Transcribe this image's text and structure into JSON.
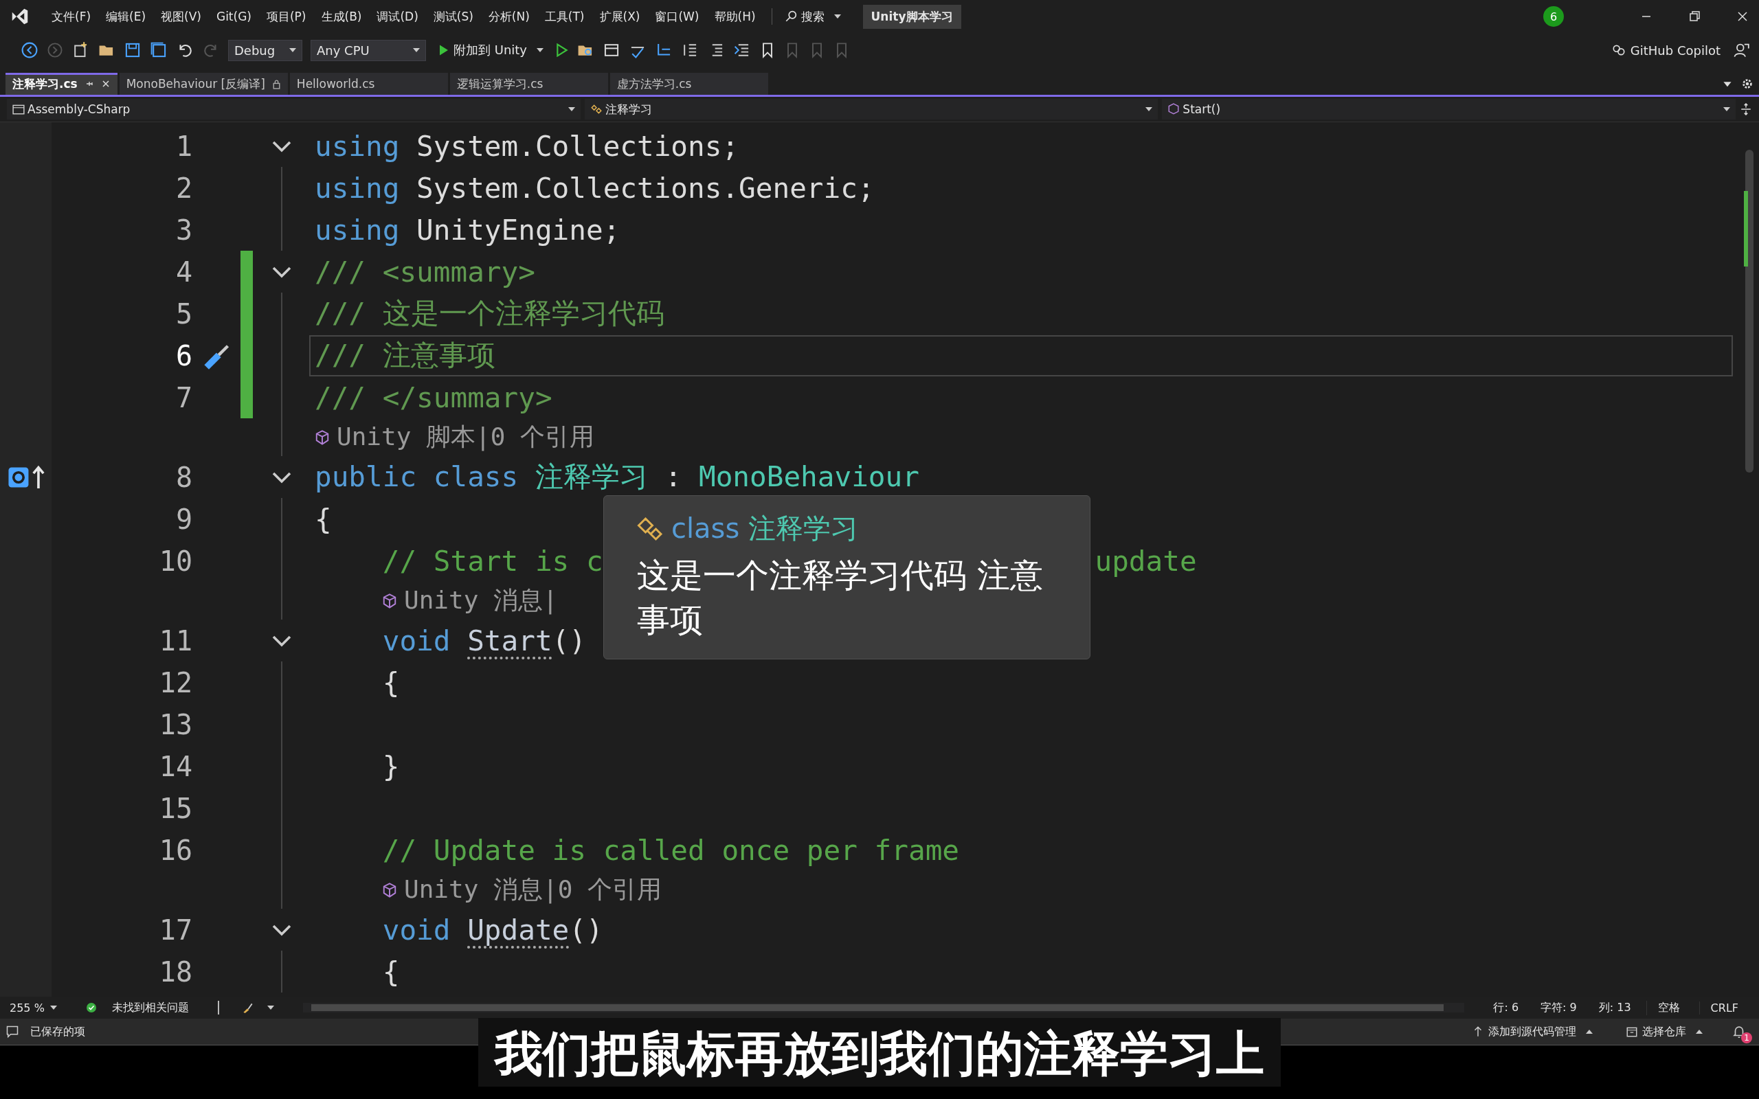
{
  "menu": [
    "文件(F)",
    "编辑(E)",
    "视图(V)",
    "Git(G)",
    "项目(P)",
    "生成(B)",
    "调试(D)",
    "测试(S)",
    "分析(N)",
    "工具(T)",
    "扩展(X)",
    "窗口(W)",
    "帮助(H)"
  ],
  "search": "搜索",
  "solution_title": "Unity脚本学习",
  "notification_count": "6",
  "toolbar": {
    "configuration": "Debug",
    "platform": "Any CPU",
    "run_button": "附加到 Unity",
    "copilot": "GitHub Copilot"
  },
  "tabs": [
    {
      "label": "注释学习.cs",
      "selected": true,
      "locked": false
    },
    {
      "label": "MonoBehaviour [反编译]",
      "selected": false,
      "locked": true
    },
    {
      "label": "Helloworld.cs",
      "selected": false,
      "locked": false
    },
    {
      "label": "逻辑运算学习.cs",
      "selected": false,
      "locked": false
    },
    {
      "label": "虚方法学习.cs",
      "selected": false,
      "locked": false
    }
  ],
  "nav": {
    "project": "Assembly-CSharp",
    "type": "注释学习",
    "member": "Start()"
  },
  "lines": [
    {
      "kind": "code",
      "number": "1",
      "fold": true,
      "changed": false,
      "current": false,
      "quick_action": false,
      "marker": false,
      "tokens": [
        {
          "text": "using",
          "kind": "kw"
        },
        {
          "text": " System.Collections;",
          "kind": "plain"
        }
      ]
    },
    {
      "kind": "code",
      "number": "2",
      "fold": false,
      "changed": false,
      "current": false,
      "quick_action": false,
      "marker": false,
      "tokens": [
        {
          "text": "using",
          "kind": "kw"
        },
        {
          "text": " System.Collections.Generic;",
          "kind": "plain"
        }
      ]
    },
    {
      "kind": "code",
      "number": "3",
      "fold": false,
      "changed": false,
      "current": false,
      "quick_action": false,
      "marker": false,
      "tokens": [
        {
          "text": "using",
          "kind": "kw"
        },
        {
          "text": " UnityEngine;",
          "kind": "plain"
        }
      ]
    },
    {
      "kind": "code",
      "number": "4",
      "fold": true,
      "changed": true,
      "current": false,
      "quick_action": false,
      "marker": false,
      "tokens": [
        {
          "text": "/// <summary>",
          "kind": "doc"
        }
      ]
    },
    {
      "kind": "code",
      "number": "5",
      "fold": false,
      "changed": true,
      "current": false,
      "quick_action": false,
      "marker": false,
      "tokens": [
        {
          "text": "/// 这是一个注释学习代码",
          "kind": "doc"
        }
      ]
    },
    {
      "kind": "code",
      "number": "6",
      "fold": false,
      "changed": true,
      "current": true,
      "quick_action": true,
      "marker": false,
      "tokens": [
        {
          "text": "/// 注意事项",
          "kind": "doc"
        }
      ]
    },
    {
      "kind": "code",
      "number": "7",
      "fold": false,
      "changed": true,
      "current": false,
      "quick_action": false,
      "marker": false,
      "tokens": [
        {
          "text": "/// </summary>",
          "kind": "doc"
        }
      ]
    },
    {
      "kind": "lens",
      "indented": false,
      "text": "Unity 脚本|0 个引用"
    },
    {
      "kind": "code",
      "number": "8",
      "fold": true,
      "changed": false,
      "current": false,
      "quick_action": false,
      "marker": true,
      "tokens": [
        {
          "text": "public class ",
          "kind": "kw"
        },
        {
          "text": "注释学习",
          "kind": "type"
        },
        {
          "text": " : ",
          "kind": "plain"
        },
        {
          "text": "MonoBehaviour",
          "kind": "type"
        }
      ]
    },
    {
      "kind": "code",
      "number": "9",
      "fold": false,
      "changed": false,
      "current": false,
      "quick_action": false,
      "marker": false,
      "tokens": [
        {
          "text": "{",
          "kind": "plain"
        }
      ]
    },
    {
      "kind": "code",
      "number": "10",
      "fold": false,
      "changed": false,
      "current": false,
      "quick_action": false,
      "marker": false,
      "tokens": [
        {
          "text": "    // Start is c",
          "kind": "comment"
        },
        {
          "text": "update",
          "kind": "comment-tail"
        }
      ]
    },
    {
      "kind": "lens",
      "indented": true,
      "text": "Unity 消息|"
    },
    {
      "kind": "code",
      "number": "11",
      "fold": true,
      "changed": false,
      "current": false,
      "quick_action": false,
      "marker": false,
      "tokens": [
        {
          "text": "    void ",
          "kind": "kw"
        },
        {
          "text": "Start",
          "kind": "method"
        },
        {
          "text": "()",
          "kind": "plain"
        }
      ]
    },
    {
      "kind": "code",
      "number": "12",
      "fold": false,
      "changed": false,
      "current": false,
      "quick_action": false,
      "marker": false,
      "tokens": [
        {
          "text": "    {",
          "kind": "plain"
        }
      ]
    },
    {
      "kind": "code",
      "number": "13",
      "fold": false,
      "changed": false,
      "current": false,
      "quick_action": false,
      "marker": false
    },
    {
      "kind": "code",
      "number": "14",
      "fold": false,
      "changed": false,
      "current": false,
      "quick_action": false,
      "marker": false,
      "tokens": [
        {
          "text": "    }",
          "kind": "plain"
        }
      ]
    },
    {
      "kind": "code",
      "number": "15",
      "fold": false,
      "changed": false,
      "current": false,
      "quick_action": false,
      "marker": false
    },
    {
      "kind": "code",
      "number": "16",
      "fold": false,
      "changed": false,
      "current": false,
      "quick_action": false,
      "marker": false,
      "tokens": [
        {
          "text": "    // Update is called once per frame",
          "kind": "comment"
        }
      ]
    },
    {
      "kind": "lens",
      "indented": true,
      "text": "Unity 消息|0 个引用"
    },
    {
      "kind": "code",
      "number": "17",
      "fold": true,
      "changed": false,
      "current": false,
      "quick_action": false,
      "marker": false,
      "tokens": [
        {
          "text": "    void ",
          "kind": "kw"
        },
        {
          "text": "Update",
          "kind": "method"
        },
        {
          "text": "()",
          "kind": "plain"
        }
      ]
    },
    {
      "kind": "code",
      "number": "18",
      "fold": false,
      "changed": false,
      "current": false,
      "quick_action": false,
      "marker": false,
      "tokens": [
        {
          "text": "    {",
          "kind": "plain"
        }
      ]
    }
  ],
  "tooltip": {
    "keyword": "class",
    "name": "注释学习",
    "body": "这是一个注释学习代码 注意事项"
  },
  "editor_status": {
    "zoom": "255 %",
    "issues": "未找到相关问题",
    "line": "行: 6",
    "char": "字符: 9",
    "col": "列: 13",
    "indent": "空格",
    "eol": "CRLF"
  },
  "status_bar": {
    "message": "已保存的项",
    "source_control": "添加到源代码管理",
    "repo": "选择仓库",
    "notifications": "1"
  },
  "subtitle": "我们把鼠标再放到我们的注释学习上"
}
